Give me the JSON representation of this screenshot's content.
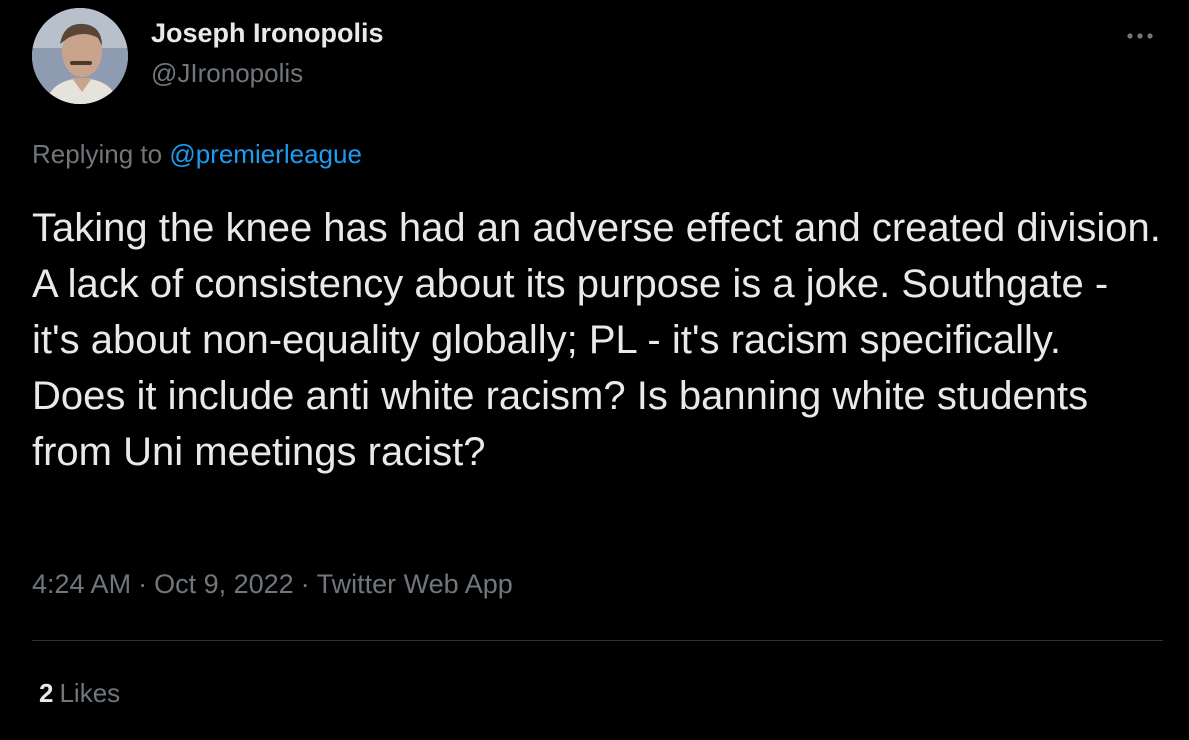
{
  "author": {
    "display_name": "Joseph Ironopolis",
    "handle": "@JIronopolis",
    "avatar_icon": "profile-photo"
  },
  "more_icon": "ellipsis-icon",
  "reply": {
    "prefix": "Replying to",
    "mention": "@premierleague"
  },
  "tweet": {
    "text": "Taking the knee has had an adverse effect and created division. A lack of consistency about its purpose is a joke. Southgate - it's about non-equality globally; PL - it's racism specifically. Does it include anti white racism? Is banning white students from Uni meetings racist?"
  },
  "meta": {
    "time": "4:24 AM",
    "separator": "·",
    "date": "Oct 9, 2022",
    "source": "Twitter Web App"
  },
  "stats": {
    "likes_count": "2",
    "likes_label": "Likes"
  },
  "colors": {
    "background": "#000000",
    "text_primary": "#e7e9ea",
    "text_secondary": "#71767b",
    "link": "#1d9bf0",
    "divider": "#2f3336"
  }
}
